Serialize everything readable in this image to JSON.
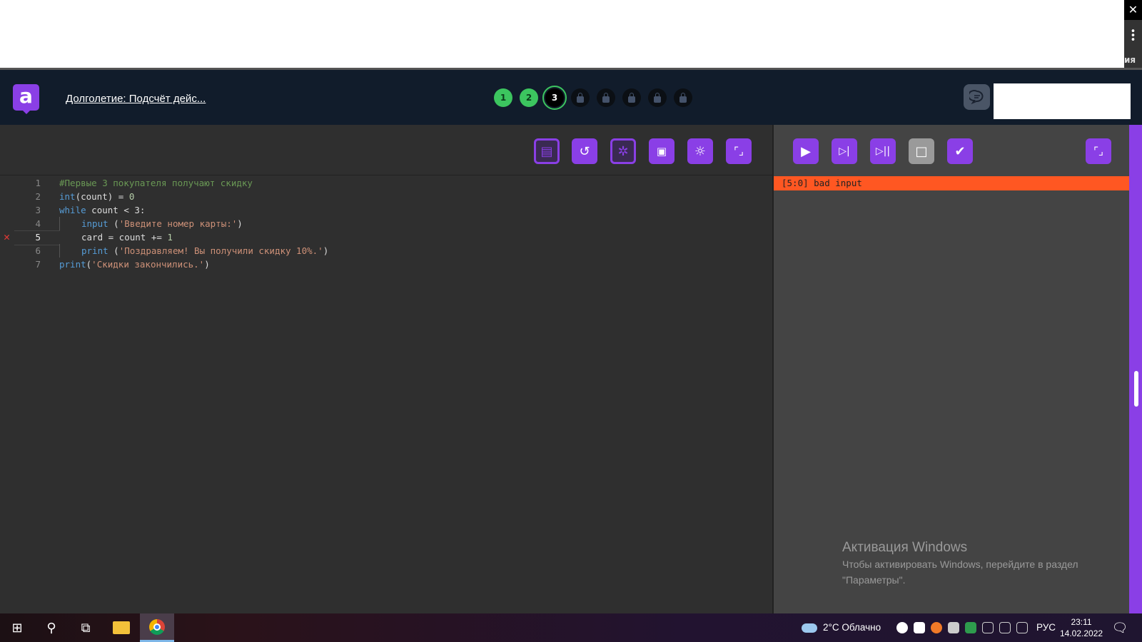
{
  "browser": {
    "close_glyph": "✕",
    "menu_glyph": "⋮",
    "side_text": "ия"
  },
  "header": {
    "logo_letter": "a",
    "title": "Долголетие: Подсчёт дейс...",
    "steps": [
      {
        "label": "1",
        "state": "done"
      },
      {
        "label": "2",
        "state": "done"
      },
      {
        "label": "3",
        "state": "current"
      },
      {
        "label": "",
        "state": "locked"
      },
      {
        "label": "",
        "state": "locked"
      },
      {
        "label": "",
        "state": "locked"
      },
      {
        "label": "",
        "state": "locked"
      },
      {
        "label": "",
        "state": "locked"
      }
    ]
  },
  "editor": {
    "toolbar": [
      "load-file",
      "reset",
      "debug",
      "save",
      "theme",
      "expand"
    ],
    "error_line": 5,
    "lines": [
      {
        "n": "1",
        "indent": 0,
        "tokens": [
          [
            "com",
            "#Первые 3 покупателя получают скидку"
          ]
        ]
      },
      {
        "n": "2",
        "indent": 0,
        "tokens": [
          [
            "kw",
            "int"
          ],
          [
            "txt",
            "(count) = "
          ],
          [
            "num",
            "0"
          ]
        ]
      },
      {
        "n": "3",
        "indent": 0,
        "tokens": [
          [
            "kw",
            "while"
          ],
          [
            "txt",
            " count < 3:"
          ]
        ]
      },
      {
        "n": "4",
        "indent": 1,
        "tokens": [
          [
            "kw",
            "input"
          ],
          [
            "txt",
            " ("
          ],
          [
            "str",
            "'Введите номер карты:'"
          ],
          [
            "txt",
            ")"
          ]
        ]
      },
      {
        "n": "5",
        "indent": 1,
        "tokens": [
          [
            "txt",
            "card = count += "
          ],
          [
            "num",
            "1"
          ]
        ]
      },
      {
        "n": "6",
        "indent": 1,
        "tokens": [
          [
            "kw",
            "print"
          ],
          [
            "txt",
            " ("
          ],
          [
            "str",
            "'Поздравляем! Вы получили скидку 10%.'"
          ],
          [
            "txt",
            ")"
          ]
        ]
      },
      {
        "n": "7",
        "indent": 0,
        "tokens": [
          [
            "kw",
            "print"
          ],
          [
            "txt",
            "("
          ],
          [
            "str",
            "'Скидки закончились.'"
          ],
          [
            "txt",
            ")"
          ]
        ]
      }
    ]
  },
  "output": {
    "error_text": "[5:0] bad input",
    "controls": [
      "run",
      "step",
      "step-over",
      "stop",
      "check",
      "expand"
    ]
  },
  "watermark": {
    "title": "Активация Windows",
    "line1": "Чтобы активировать Windows, перейдите в раздел",
    "line2": "\"Параметры\"."
  },
  "taskbar": {
    "weather": "2°C  Облачно",
    "language": "РУС",
    "time": "23:11",
    "date": "14.02.2022"
  },
  "colors": {
    "accent": "#8a3fe6",
    "success": "#3cc55f",
    "error": "#ff5722",
    "header": "#111c2b"
  }
}
